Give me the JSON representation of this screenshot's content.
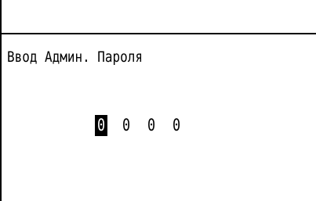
{
  "screen": {
    "title": "Ввод Админ. Пароля"
  },
  "pin": {
    "digits": [
      "0",
      "0",
      "0",
      "0"
    ],
    "selected_index": 0
  }
}
